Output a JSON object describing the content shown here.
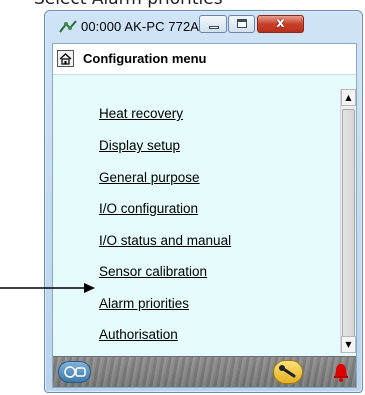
{
  "caption": "Select Alarm priorities",
  "window": {
    "title": "00:000 AK-PC 772A",
    "controls": {
      "close_glyph": "x"
    }
  },
  "header": {
    "title": "Configuration menu"
  },
  "menu": {
    "items": [
      "Heat recovery",
      "Display setup",
      "General purpose",
      "I/O configuration",
      "I/O status and manual",
      "Sensor calibration",
      "Alarm priorities",
      "Authorisation"
    ]
  },
  "scrollbar": {
    "up_glyph": "▲",
    "down_glyph": "▼"
  },
  "icons": {
    "app": "network-icon",
    "home": "home-icon",
    "footer_left": "controller-icon",
    "footer_tool": "wrench-icon",
    "alarm": "alarm-bell-icon",
    "pointer": "arrow-right-icon"
  },
  "colors": {
    "client_bg": "#e6fbfb",
    "close_button": "#c9402a",
    "alarm": "#e00000",
    "tool_button": "#f0c23a"
  }
}
